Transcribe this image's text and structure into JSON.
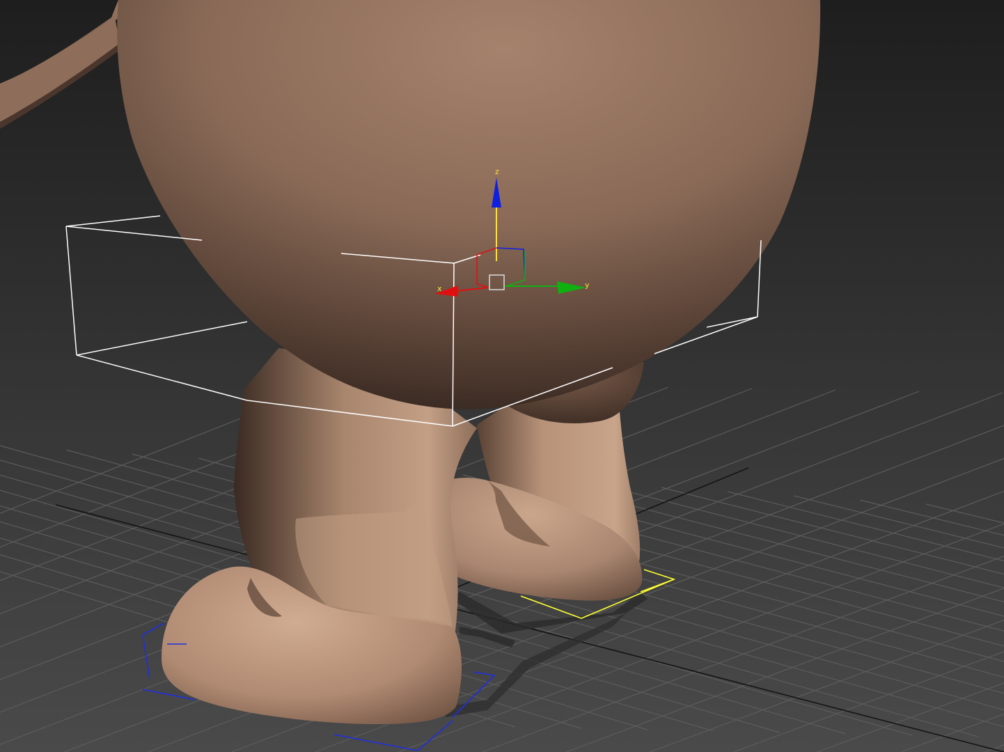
{
  "viewport": {
    "background_top": "#1e1e1e",
    "background_bottom": "#4a4a4a",
    "grid_color": "#5c5c5c",
    "grid_axis_color": "#141414"
  },
  "character": {
    "skin_light": "#c9a58b",
    "skin_mid": "#9a7763",
    "skin_dark": "#3c2c24"
  },
  "selection": {
    "bounding_box_color": "#ffffff",
    "foot_helper_left_color": "#1f2fe0",
    "foot_helper_right_color": "#ffff33",
    "arm_helper_color": "#22dd22"
  },
  "gizmo": {
    "x_label": "x",
    "y_label": "y",
    "z_label": "z",
    "x_color": "#e01010",
    "y_color": "#10b010",
    "z_color": "#1020e0",
    "z_shaft_color": "#ffe040",
    "label_color": "#ffe040",
    "center_box_color": "#dcdcdc"
  }
}
